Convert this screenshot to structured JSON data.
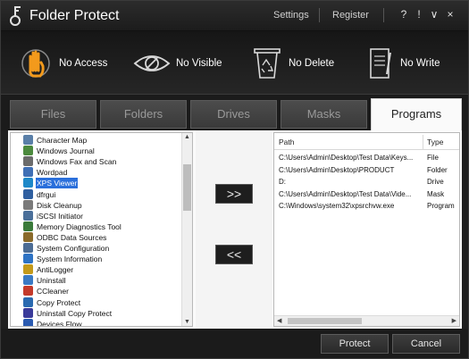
{
  "window": {
    "title": "Folder Protect",
    "links": [
      "Settings",
      "Register"
    ],
    "controls": [
      "?",
      "!",
      "∨",
      "×"
    ]
  },
  "modes": [
    {
      "label": "No Access",
      "icon": "hand-stop-icon"
    },
    {
      "label": "No Visible",
      "icon": "eye-hidden-icon"
    },
    {
      "label": "No Delete",
      "icon": "recycle-bin-icon"
    },
    {
      "label": "No Write",
      "icon": "notepad-icon"
    }
  ],
  "tabs": [
    {
      "label": "Files",
      "active": false
    },
    {
      "label": "Folders",
      "active": false
    },
    {
      "label": "Drives",
      "active": false
    },
    {
      "label": "Masks",
      "active": false
    },
    {
      "label": "Programs",
      "active": true
    }
  ],
  "programs_list": {
    "items": [
      {
        "label": "Character Map",
        "icon": "charmap-icon",
        "color": "#5a7fa8"
      },
      {
        "label": "Windows Journal",
        "icon": "journal-icon",
        "color": "#4c8a3e"
      },
      {
        "label": "Windows Fax and Scan",
        "icon": "fax-icon",
        "color": "#6b6b6b"
      },
      {
        "label": "Wordpad",
        "icon": "wordpad-icon",
        "color": "#3f6fb5"
      },
      {
        "label": "XPS Viewer",
        "icon": "xps-icon",
        "color": "#1e88c8",
        "selected": true
      },
      {
        "label": "dfrgui",
        "icon": "defrag-icon",
        "color": "#2f5fa0"
      },
      {
        "label": "Disk Cleanup",
        "icon": "disk-cleanup-icon",
        "color": "#7a7a7a"
      },
      {
        "label": "iSCSI Initiator",
        "icon": "iscsi-icon",
        "color": "#4a6f9a"
      },
      {
        "label": "Memory Diagnostics Tool",
        "icon": "memory-icon",
        "color": "#3a7a3a"
      },
      {
        "label": "ODBC Data Sources",
        "icon": "odbc-icon",
        "color": "#8a6a2a"
      },
      {
        "label": "System Configuration",
        "icon": "msconfig-icon",
        "color": "#4c6c94"
      },
      {
        "label": "System Information",
        "icon": "sysinfo-icon",
        "color": "#2e73c4"
      },
      {
        "label": "AntiLogger",
        "icon": "antilogger-icon",
        "color": "#c49a1a"
      },
      {
        "label": "Uninstall",
        "icon": "uninstall-icon",
        "color": "#3a7ac4"
      },
      {
        "label": "CCleaner",
        "icon": "ccleaner-icon",
        "color": "#c43a2a"
      },
      {
        "label": "Copy Protect",
        "icon": "copy-protect-icon",
        "color": "#2a6ab0"
      },
      {
        "label": "Uninstall Copy Protect",
        "icon": "uninstall-copy-protect-icon",
        "color": "#3a3a9a"
      },
      {
        "label": "Devices Flow",
        "icon": "devices-flow-icon",
        "color": "#2a5ab0"
      }
    ]
  },
  "transfer": {
    "add_label": ">>",
    "remove_label": "<<"
  },
  "protected_table": {
    "columns": [
      "Path",
      "Type"
    ],
    "rows": [
      {
        "path": "C:\\Users\\Admin\\Desktop\\Test Data\\Keys...",
        "type": "File"
      },
      {
        "path": "C:\\Users\\Admin\\Desktop\\PRODUCT",
        "type": "Folder"
      },
      {
        "path": "D:",
        "type": "Drive"
      },
      {
        "path": "C:\\Users\\Admin\\Desktop\\Test Data\\Vide...",
        "type": "Mask"
      },
      {
        "path": "C:\\Windows\\system32\\xpsrchvw.exe",
        "type": "Program"
      }
    ]
  },
  "actions": {
    "protect_label": "Protect",
    "cancel_label": "Cancel"
  }
}
